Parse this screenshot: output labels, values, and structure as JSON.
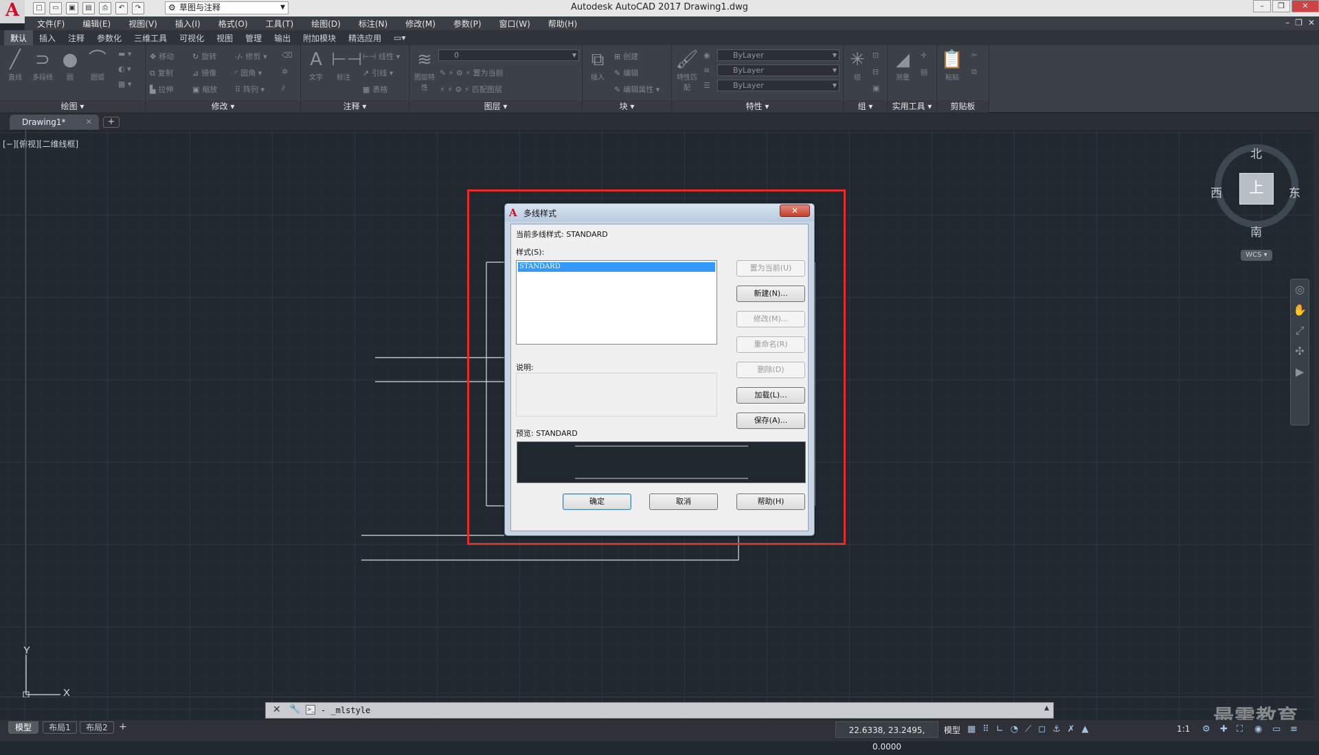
{
  "app": {
    "logo": "A",
    "title": "Autodesk AutoCAD 2017    Drawing1.dwg",
    "workspace": "草图与注释"
  },
  "menu": [
    "文件(F)",
    "编辑(E)",
    "视图(V)",
    "插入(I)",
    "格式(O)",
    "工具(T)",
    "绘图(D)",
    "标注(N)",
    "修改(M)",
    "参数(P)",
    "窗口(W)",
    "帮助(H)"
  ],
  "ribbon_tabs": [
    "默认",
    "插入",
    "注释",
    "参数化",
    "三维工具",
    "可视化",
    "视图",
    "管理",
    "输出",
    "附加模块",
    "精选应用"
  ],
  "ribbon": {
    "panels": {
      "draw": "绘图",
      "modify": "修改",
      "annotate": "注释",
      "layers": "图层",
      "block": "块",
      "properties": "特性",
      "group": "组",
      "utilities": "实用工具",
      "clipboard": "剪贴板"
    },
    "draw_tools": [
      "直线",
      "多段线",
      "圆",
      "圆弧"
    ],
    "modify_tools": [
      "移动",
      "旋转",
      "修剪",
      "复制",
      "镜像",
      "圆角",
      "拉伸",
      "缩放",
      "阵列"
    ],
    "annotate_tools": {
      "text": "文字",
      "dim": "标注",
      "linear": "线性",
      "leader": "引线",
      "table": "表格"
    },
    "layer_tools": {
      "props": "图层特性",
      "current_layer": "0",
      "make_current": "置为当前",
      "match": "匹配图层"
    },
    "block_tools": {
      "insert": "插入",
      "create": "创建",
      "edit": "编辑",
      "edit_attr": "编辑属性"
    },
    "props": {
      "match": "特性匹配",
      "color": "ByLayer",
      "linetype": "ByLayer",
      "lineweight": "ByLayer"
    },
    "group_label": "组",
    "measure": "测量",
    "paste": "粘贴"
  },
  "file_tab": {
    "name": "Drawing1*"
  },
  "viewport_label": "[−][俯视][二维线框]",
  "viewcube": {
    "top": "上",
    "north": "北",
    "south": "南",
    "east": "东",
    "west": "西",
    "wcs": "WCS"
  },
  "ucs": {
    "x": "X",
    "y": "Y"
  },
  "dialog": {
    "title": "多线样式",
    "current_style_label": "当前多线样式: STANDARD",
    "styles_label": "样式(S):",
    "styles": [
      "STANDARD"
    ],
    "description_label": "说明:",
    "preview_label": "预览: STANDARD",
    "buttons": {
      "set_current": "置为当前(U)",
      "new": "新建(N)...",
      "modify": "修改(M)...",
      "rename": "重命名(R)",
      "delete": "删除(D)",
      "load": "加载(L)...",
      "save": "保存(A)...",
      "ok": "确定",
      "cancel": "取消",
      "help": "帮助(H)"
    }
  },
  "command_line": {
    "text": "- _mlstyle"
  },
  "layout_tabs": [
    "模型",
    "布局1",
    "布局2"
  ],
  "status": {
    "coords": "22.6338, 23.2495, 0.0000",
    "model": "模型",
    "scale": "1:1"
  },
  "watermark": "最需教育"
}
